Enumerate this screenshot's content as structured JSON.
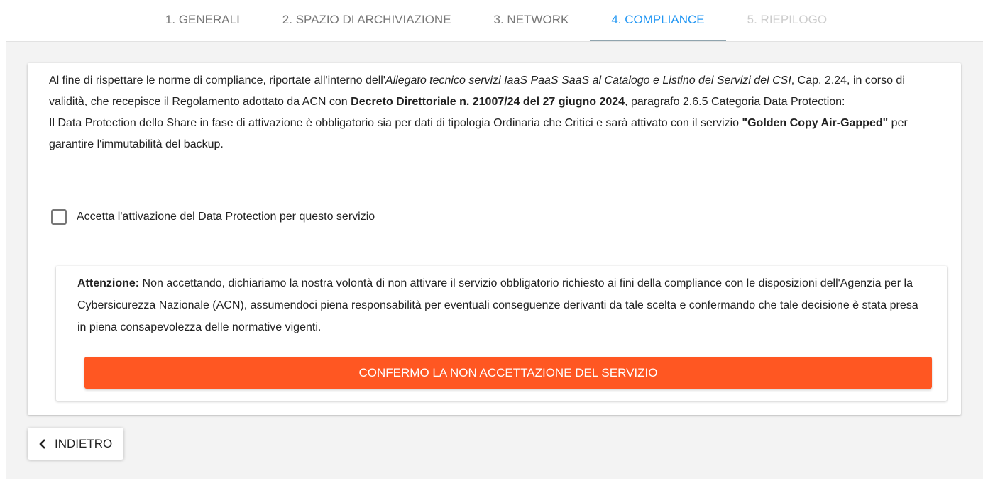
{
  "tabs": [
    {
      "label": "1. GENERALI"
    },
    {
      "label": "2. SPAZIO DI ARCHIVIAZIONE"
    },
    {
      "label": "3. NETWORK"
    },
    {
      "label": "4. COMPLIANCE",
      "active": true
    },
    {
      "label": "5. RIEPILOGO",
      "disabled": true
    }
  ],
  "intro": {
    "p1": "Al fine di rispettare le norme di compliance, riportate all'interno dell'",
    "p1_italic": "Allegato tecnico servizi IaaS PaaS SaaS al Catalogo e Listino dei Servizi del CSI",
    "p2": ", Cap. 2.24, in corso di validità, che recepisce il Regolamento adottato da ACN con ",
    "p2_bold": "Decreto Direttoriale n. 21007/24 del 27 giugno 2024",
    "p3": ", paragrafo 2.6.5 Categoria Data Protection:",
    "p4": "Il Data Protection dello Share in fase di attivazione è obbligatorio sia per dati di tipologia Ordinaria che Critici e sarà attivato con il servizio ",
    "p4_bold": "\"Golden Copy Air-Gapped\"",
    "p5": " per garantire l'immutabilità del backup."
  },
  "checkbox": {
    "label": "Accetta l'attivazione del Data Protection per questo servizio",
    "checked": false
  },
  "warning": {
    "title": "Attenzione:",
    "text": " Non accettando, dichiariamo la nostra volontà di non attivare il servizio obbligatorio richiesto ai fini della compliance con le disposizioni dell'Agenzia per la Cybersicurezza Nazionale (ACN), assumendoci piena responsabilità per eventuali conseguenze derivanti da tale scelta e confermando che tale decisione è stata presa in piena consapevolezza delle normative vigenti.",
    "button": "CONFERMO LA NON ACCETTAZIONE DEL SERVIZIO"
  },
  "back": {
    "label": "INDIETRO",
    "icon": "chevron-left-icon"
  },
  "colors": {
    "accent": "#2196f3",
    "danger": "#ff5722"
  }
}
